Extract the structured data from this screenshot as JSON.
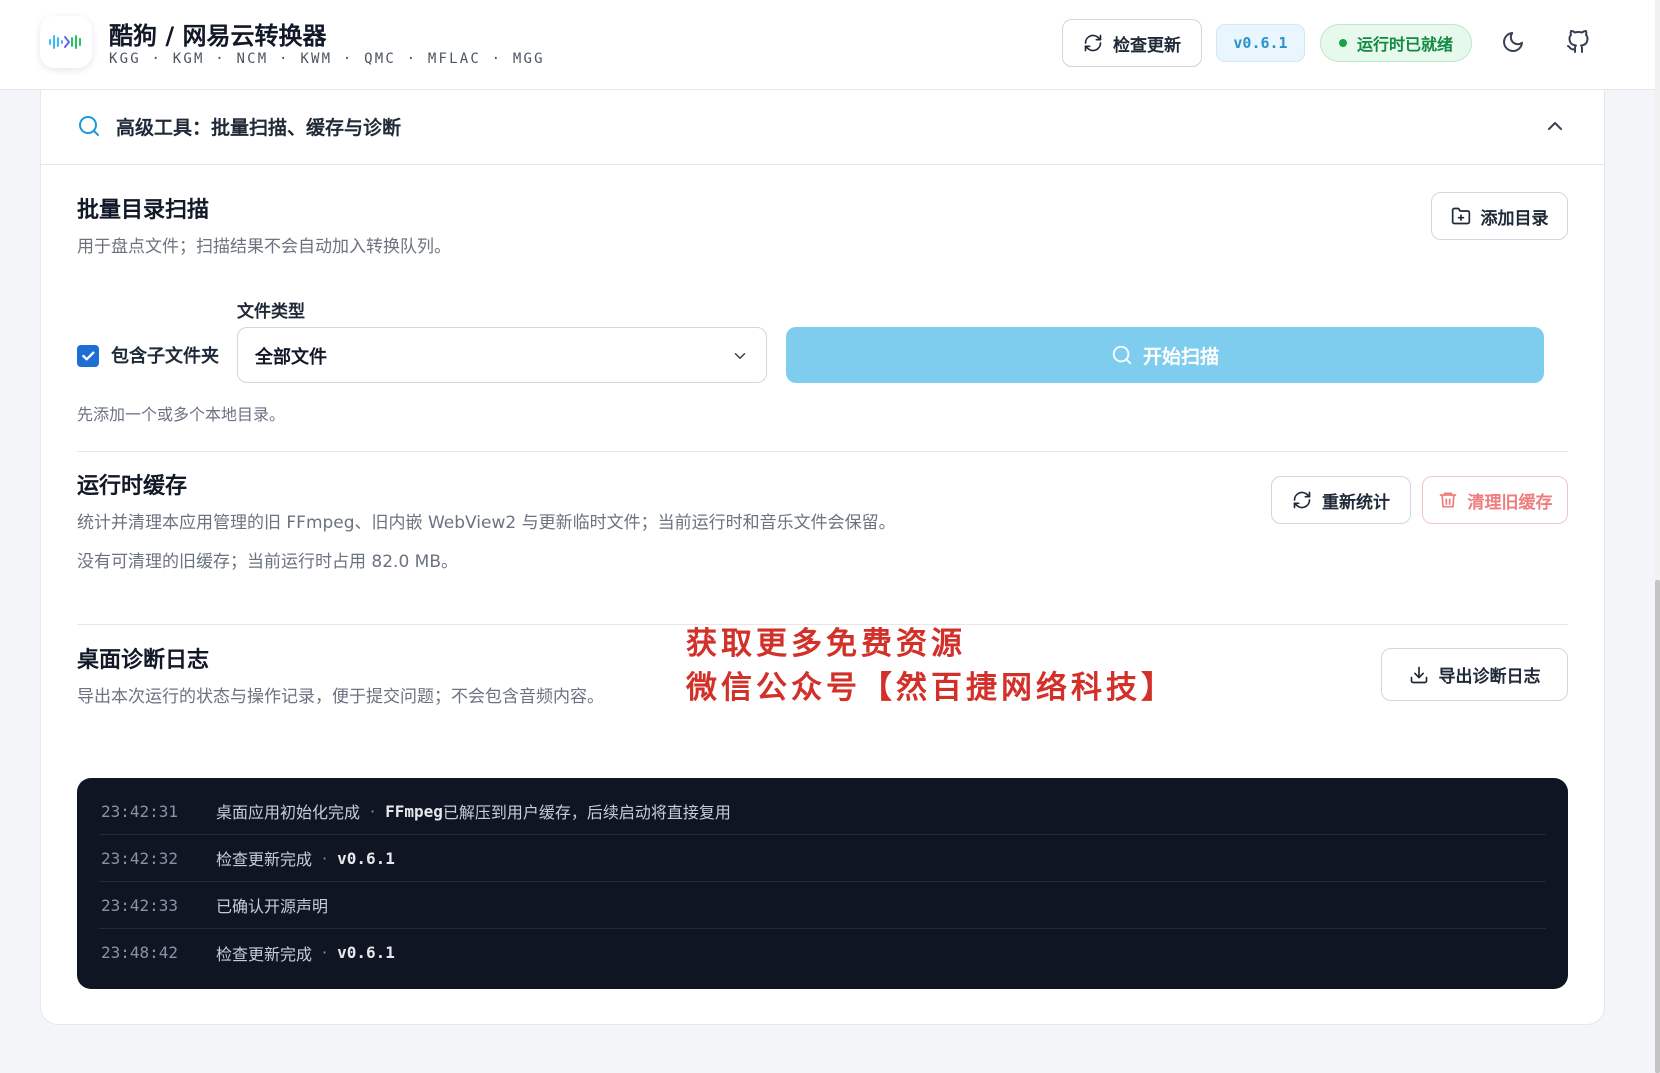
{
  "header": {
    "app_title": "酷狗 / 网易云转换器",
    "formats": "KGG · KGM · NCM · KWM · QMC · MFLAC · MGG",
    "check_update_label": "检查更新",
    "version": "v0.6.1",
    "runtime_status": "运行时已就绪",
    "colors": {
      "accent": "#2b93c9",
      "success": "#16a34a"
    }
  },
  "advanced": {
    "title": "高级工具：批量扫描、缓存与诊断"
  },
  "batch_scan": {
    "title": "批量目录扫描",
    "description": "用于盘点文件；扫描结果不会自动加入转换队列。",
    "add_dir_label": "添加目录",
    "include_subfolders_label": "包含子文件夹",
    "include_subfolders_checked": true,
    "file_type_label": "文件类型",
    "file_type_value": "全部文件",
    "start_scan_label": "开始扫描",
    "hint": "先添加一个或多个本地目录。"
  },
  "runtime_cache": {
    "title": "运行时缓存",
    "description": "统计并清理本应用管理的旧 FFmpeg、旧内嵌 WebView2 与更新临时文件；当前运行时和音乐文件会保留。",
    "status": "没有可清理的旧缓存；当前运行时占用 82.0 MB。",
    "recount_label": "重新统计",
    "clear_label": "清理旧缓存",
    "danger_color": "#ef7d7d"
  },
  "diagnostics": {
    "title": "桌面诊断日志",
    "description": "导出本次运行的状态与操作记录，便于提交问题；不会包含音频内容。",
    "export_label": "导出诊断日志",
    "logs": [
      {
        "time": "23:42:31",
        "message": "桌面应用初始化完成",
        "detail_strong": "FFmpeg",
        "detail": " 已解压到用户缓存，后续启动将直接复用"
      },
      {
        "time": "23:42:32",
        "message": "检查更新完成",
        "detail_strong": "v0.6.1",
        "detail": ""
      },
      {
        "time": "23:42:33",
        "message": "已确认开源声明",
        "detail_strong": "",
        "detail": ""
      },
      {
        "time": "23:48:42",
        "message": "检查更新完成",
        "detail_strong": "v0.6.1",
        "detail": ""
      }
    ]
  },
  "promo": {
    "line1": "获取更多免费资源",
    "line2": "微信公众号【然百捷网络科技】",
    "color": "#d2312a"
  }
}
